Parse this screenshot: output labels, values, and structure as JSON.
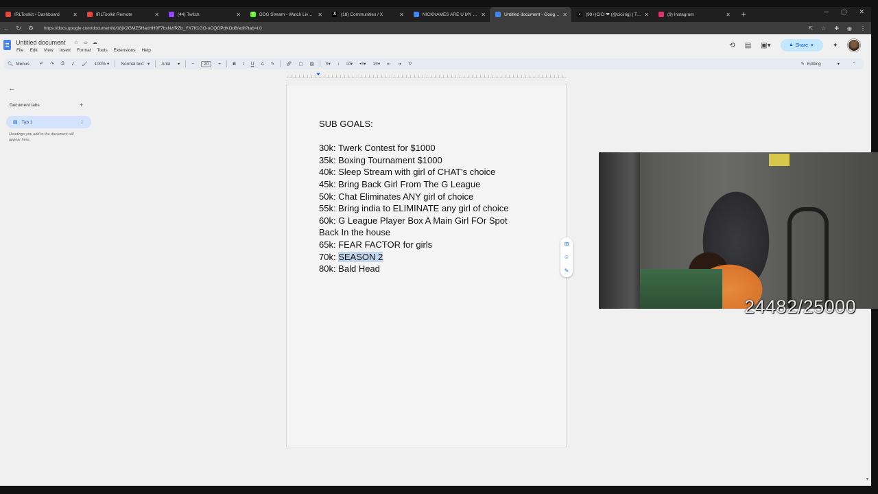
{
  "browser": {
    "tabs": [
      {
        "title": "IRLToolkit • Dashboard",
        "color": "#e8453c",
        "glyph": "",
        "active": false
      },
      {
        "title": "IRLToolkit Remote",
        "color": "#e8453c",
        "glyph": "",
        "active": false
      },
      {
        "title": "(44) Twitch",
        "color": "#9146ff",
        "glyph": "",
        "active": false
      },
      {
        "title": "DDG Stream - Watch Live on Kick",
        "color": "#53fc18",
        "glyph": "K",
        "active": false
      },
      {
        "title": "(18) Communities / X",
        "color": "#000000",
        "glyph": "X",
        "active": false
      },
      {
        "title": "NICKNAMES ARE U MY BALL - G...",
        "color": "#4285f4",
        "glyph": "",
        "active": false
      },
      {
        "title": "Untitled document - Google Docs",
        "color": "#4285f4",
        "glyph": "",
        "active": true
      },
      {
        "title": "(99+)CiCi ❤ (@cicinig) | TikTok",
        "color": "#111111",
        "glyph": "♪",
        "active": false
      },
      {
        "title": "(9) Instagram",
        "color": "#e1306c",
        "glyph": "",
        "active": false
      }
    ],
    "url": "https://docs.google.com/document/d/18jX2GMZSHacHH0F7bxNzfRZb_YX7K1GO-oCQGPdKOd8/edit?tab=t.0"
  },
  "docs": {
    "title": "Untitled document",
    "menu": [
      "File",
      "Edit",
      "View",
      "Insert",
      "Format",
      "Tools",
      "Extensions",
      "Help"
    ],
    "share_label": "Share",
    "toolbar": {
      "menus_label": "Menus",
      "zoom": "100%",
      "style": "Normal text",
      "font": "Arial",
      "font_size": "20",
      "mode": "Editing"
    },
    "sidebar": {
      "header": "Document tabs",
      "tab_label": "Tab 1",
      "hint": "Headings you add to the document will appear here."
    },
    "content": {
      "heading": "SUB GOALS:",
      "lines": [
        "30k: Twerk Contest for $1000",
        "35k: Boxing Tournament $1000",
        "40k: Sleep Stream with girl of CHAT's choice",
        "45k: Bring Back Girl From The G League",
        "50k: Chat Eliminates ANY girl of choice",
        "55k: Bring india to ELIMINATE any girl of choice",
        "60k: G League Player Box A Main Girl FOr Spot",
        "Back In the house",
        "65k: FEAR FACTOR for girls"
      ],
      "selected_prefix": "70k: ",
      "selected_text": "SEASON 2",
      "last_line": "80k: Bald Head"
    }
  },
  "overlay": {
    "sub_counter": "24482/25000"
  }
}
